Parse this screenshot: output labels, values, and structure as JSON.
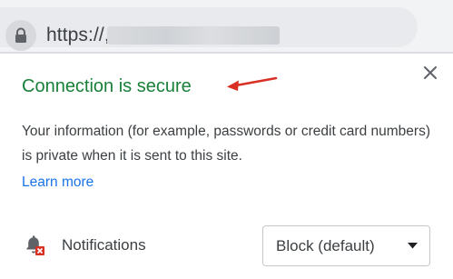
{
  "address_bar": {
    "lock_icon": "lock-icon",
    "url_text": "https://,"
  },
  "popup": {
    "title": "Connection is secure",
    "title_color": "#188038",
    "description": "Your information (for example, passwords or credit card numbers) is private when it is sent to this site.",
    "learn_more_label": "Learn more",
    "link_color": "#1a73e8",
    "close_icon": "close-icon",
    "annotation_arrow_color": "#d93025"
  },
  "permissions": {
    "notifications": {
      "icon": "bell-blocked-icon",
      "label": "Notifications",
      "selected_value": "Block (default)"
    }
  }
}
